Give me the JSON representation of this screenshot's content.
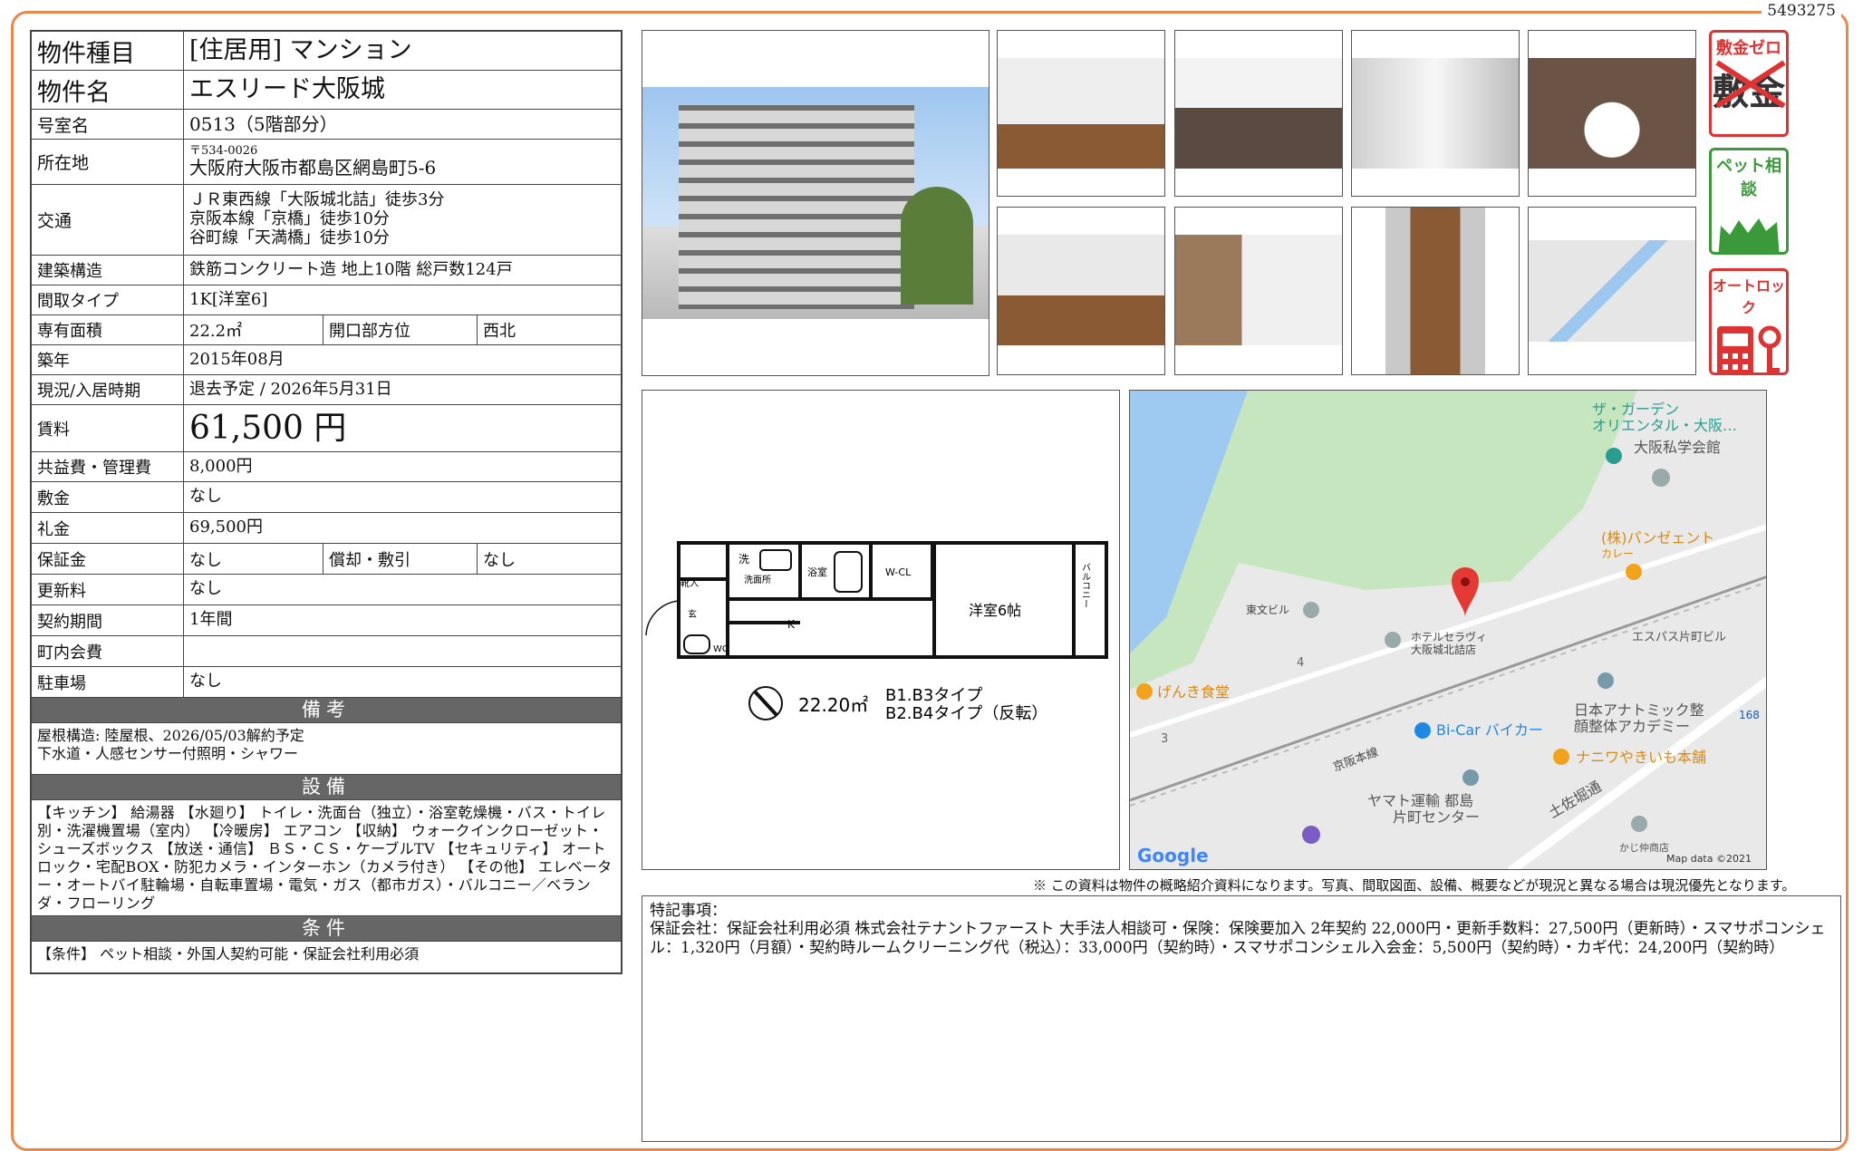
{
  "doc_id": "5493275",
  "property": {
    "type_label": "物件種目",
    "type_value": "[住居用] マンション",
    "name_label": "物件名",
    "name_value": "エスリード大阪城",
    "room_label": "号室名",
    "room_value": "0513（5階部分）",
    "address_label": "所在地",
    "zip": "〒534-0026",
    "address": "大阪府大阪市都島区網島町5-6",
    "transport_label": "交通",
    "transport": [
      "ＪＲ東西線「大阪城北詰」徒歩3分",
      "京阪本線「京橋」徒歩10分",
      "谷町線「天満橋」徒歩10分"
    ],
    "structure_label": "建築構造",
    "structure_value": "鉄筋コンクリート造 地上10階 総戸数124戸",
    "layout_label": "間取タイプ",
    "layout_value": "1K[洋室6]",
    "area_label": "専有面積",
    "area_value": "22.2㎡",
    "opening_label": "開口部方位",
    "opening_value": "西北",
    "built_label": "築年",
    "built_value": "2015年08月",
    "status_label": "現況/入居時期",
    "status_value": "退去予定 / 2026年5月31日",
    "rent_label": "賃料",
    "rent_value": "61,500 円",
    "fee_label": "共益費・管理費",
    "fee_value": "8,000円",
    "deposit_label": "敷金",
    "deposit_value": "なし",
    "keymoney_label": "礼金",
    "keymoney_value": "69,500円",
    "guarantee_label": "保証金",
    "guarantee_value": "なし",
    "amort_label": "償却・敷引",
    "amort_value": "なし",
    "renewal_label": "更新料",
    "renewal_value": "なし",
    "contract_label": "契約期間",
    "contract_value": "1年間",
    "town_label": "町内会費",
    "town_value": "",
    "parking_label": "駐車場",
    "parking_value": "なし"
  },
  "sections": {
    "remarks_title": "備考",
    "remarks_text": [
      "屋根構造: 陸屋根、2026/05/03解約予定",
      "下水道・人感センサー付照明・シャワー"
    ],
    "equipment_title": "設備",
    "equipment_text": "【キッチン】 給湯器 【水廻り】 トイレ・洗面台（独立）・浴室乾燥機・バス・トイレ別・洗濯機置場（室内） 【冷暖房】 エアコン 【収納】 ウォークインクローゼット・シューズボックス 【放送・通信】 ＢＳ・ＣＳ・ケーブルTV 【セキュリティ】 オートロック・宅配BOX・防犯カメラ・インターホン（カメラ付き） 【その他】 エレベーター・オートバイ駐輪場・自転車置場・電気・ガス（都市ガス）・バルコニー／ベランダ・フローリング",
    "conditions_title": "条件",
    "conditions_text": "【条件】 ペット相談・外国人契約可能・保証会社利用必須"
  },
  "badges": {
    "shikikin_zero": "敷金ゼロ",
    "shikikin_char": "敷金",
    "pet": "ペット相談",
    "autolock": "オートロック"
  },
  "floorplan": {
    "area": "22.20㎡",
    "type1": "B1.B3タイプ",
    "type2": "B2.B4タイプ（反転）",
    "room": "洋室6帖",
    "wcl": "W-CL",
    "balcony": "バルコニー",
    "k": "K",
    "bath": "浴室",
    "wash": "洗面所",
    "entry": "靴入",
    "wc": "WC",
    "sen": "洗",
    "gen": "玄"
  },
  "map": {
    "labels": [
      "ザ・ガーデン",
      "オリエンタル・大阪…",
      "大阪私学会館",
      "(株)パンゼェント",
      "カレー",
      "東文ビル",
      "ホテルセラヴィ",
      "大阪城北詰店",
      "エスパス片町ビル",
      "げんき食堂",
      "日本アナトミック整",
      "顔整体アカデミー",
      "Bi-Car バイカー",
      "京阪本線",
      "ナニワやきいも本舗",
      "ヤマト運輸 都島",
      "片町センター",
      "土佐堀通",
      "かじ仲商店",
      "168",
      "4",
      "3"
    ],
    "logo": "Google",
    "credit": "Map data ©2021"
  },
  "disclaimer": "※ この資料は物件の概略紹介資料になります。写真、間取図面、設備、概要などが現況と異なる場合は現況優先となります。",
  "special": {
    "title": "特記事項：",
    "text": "保証会社：保証会社利用必須 株式会社テナントファースト 大手法人相談可・保険：保険要加入 2年契約 22,000円・更新手数料：27,500円（更新時）・スマサポコンシェル：1,320円（月額）・契約時ルームクリーニング代（税込）：33,000円（契約時）・スマサポコンシェル入会金：5,500円（契約時）・カギ代：24,200円（契約時）"
  },
  "colors": {
    "frame": "#e8894a",
    "badge_red": "#d33",
    "badge_green": "#3a9a3a",
    "section_bg": "#666",
    "map_pin": "#e53935"
  }
}
